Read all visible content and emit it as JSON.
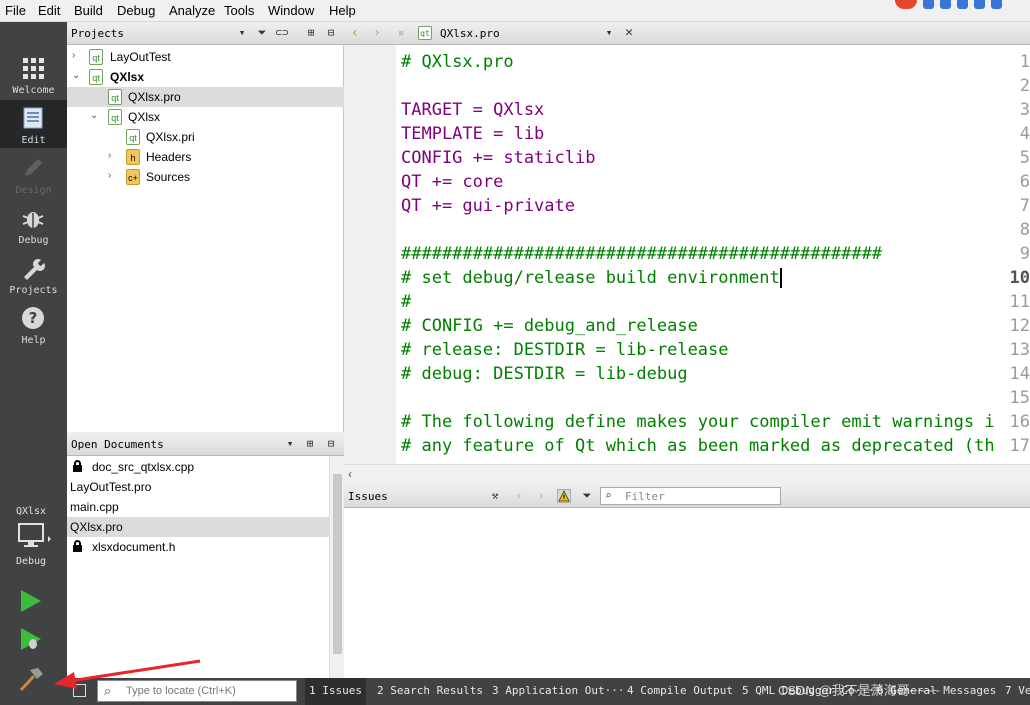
{
  "menu": [
    "File",
    "Edit",
    "Build",
    "Debug",
    "Analyze",
    "Tools",
    "Window",
    "Help"
  ],
  "modes": [
    {
      "label": "Welcome",
      "icon": "grid-icon"
    },
    {
      "label": "Edit",
      "icon": "document-icon"
    },
    {
      "label": "Design",
      "icon": "pencil-icon"
    },
    {
      "label": "Debug",
      "icon": "bug-icon"
    },
    {
      "label": "Projects",
      "icon": "wrench-icon"
    },
    {
      "label": "Help",
      "icon": "help-icon"
    }
  ],
  "kit": {
    "project": "QXlsx",
    "build": "Debug"
  },
  "projects": {
    "title": "Projects",
    "tree": [
      {
        "label": "LayOutTest"
      },
      {
        "label": "QXlsx"
      },
      {
        "label": "QXlsx.pro"
      },
      {
        "label": "QXlsx"
      },
      {
        "label": "QXlsx.pri"
      },
      {
        "label": "Headers"
      },
      {
        "label": "Sources"
      }
    ]
  },
  "open_documents": {
    "title": "Open Documents",
    "items": [
      {
        "label": "doc_src_qtxlsx.cpp"
      },
      {
        "label": "LayOutTest.pro"
      },
      {
        "label": "main.cpp"
      },
      {
        "label": "QXlsx.pro"
      },
      {
        "label": "xlsxdocument.h"
      }
    ]
  },
  "editor": {
    "file": "QXlsx.pro",
    "lines": [
      {
        "n": "1",
        "text": "# QXlsx.pro"
      },
      {
        "n": "2",
        "text": ""
      },
      {
        "n": "3",
        "text": "TARGET = QXlsx"
      },
      {
        "n": "4",
        "text": "TEMPLATE = lib"
      },
      {
        "n": "5",
        "text": "CONFIG += staticlib"
      },
      {
        "n": "6",
        "text": "QT += core"
      },
      {
        "n": "7",
        "text": "QT += gui-private"
      },
      {
        "n": "8",
        "text": ""
      },
      {
        "n": "9",
        "text": "###############################################"
      },
      {
        "n": "10",
        "text": "# set debug/release build environment"
      },
      {
        "n": "11",
        "text": "#"
      },
      {
        "n": "12",
        "text": "# CONFIG += debug_and_release"
      },
      {
        "n": "13",
        "text": "# release: DESTDIR = lib-release"
      },
      {
        "n": "14",
        "text": "# debug: DESTDIR = lib-debug"
      },
      {
        "n": "15",
        "text": ""
      },
      {
        "n": "16",
        "text": "# The following define makes your compiler emit warnings i"
      },
      {
        "n": "17",
        "text": "# any feature of Qt which as been marked as deprecated (th"
      }
    ]
  },
  "issues": {
    "title": "Issues",
    "filter_placeholder": "Filter"
  },
  "status": {
    "locate_placeholder": "Type to locate (Ctrl+K)",
    "tabs": [
      "1 Issues",
      "2 Search Results",
      "3 Application Out···",
      "4 Compile Output",
      "5 QML Debugger Co···",
      "6 General Messages",
      "7 Ve"
    ]
  },
  "watermark": "CSDN @我不是萧海哥~~~~"
}
